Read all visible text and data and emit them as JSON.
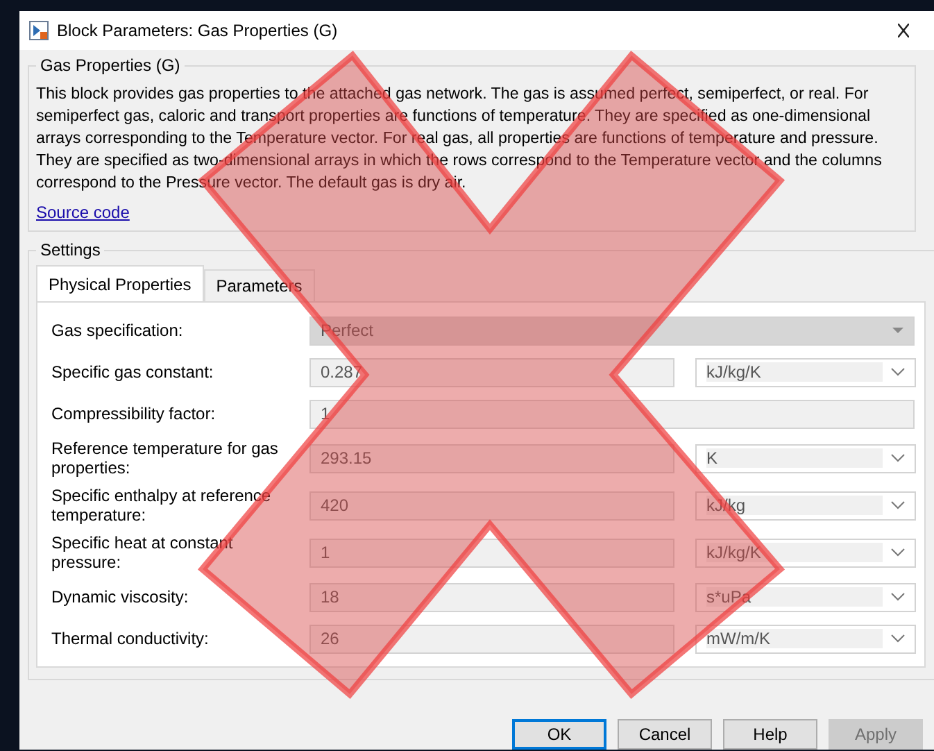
{
  "window": {
    "title": "Block Parameters: Gas Properties (G)"
  },
  "description": {
    "heading": "Gas Properties (G)",
    "text": "This block provides gas properties to the attached gas network. The gas is assumed perfect, semiperfect, or real. For semiperfect gas, caloric and transport properties are functions of temperature. They are specified as one-dimensional arrays corresponding to the Temperature vector. For real gas, all properties are functions of temperature and pressure. They are specified as two-dimensional arrays in which the rows correspond to the Temperature vector and the columns correspond to the Pressure vector. The default gas is dry air.",
    "link": "Source code"
  },
  "settings": {
    "heading": "Settings",
    "tabs": [
      {
        "label": "Physical Properties",
        "selected": true
      },
      {
        "label": "Parameters",
        "selected": false
      }
    ],
    "rows": [
      {
        "kind": "dropdown",
        "label": "Gas specification:",
        "value": "Perfect",
        "disabled": true
      },
      {
        "kind": "value_unit",
        "label": "Specific gas constant:",
        "value": "0.287",
        "unit": "kJ/kg/K",
        "disabled": true
      },
      {
        "kind": "value",
        "label": "Compressibility factor:",
        "value": "1",
        "disabled": true
      },
      {
        "kind": "value_unit",
        "label": "Reference temperature for gas properties:",
        "value": "293.15",
        "unit": "K",
        "disabled": true
      },
      {
        "kind": "value_unit",
        "label": "Specific enthalpy at reference temperature:",
        "value": "420",
        "unit": "kJ/kg",
        "disabled": true
      },
      {
        "kind": "value_unit",
        "label": "Specific heat at constant pressure:",
        "value": "1",
        "unit": "kJ/kg/K",
        "disabled": true
      },
      {
        "kind": "value_unit",
        "label": "Dynamic viscosity:",
        "value": "18",
        "unit": "s*uPa",
        "disabled": true
      },
      {
        "kind": "value_unit",
        "label": "Thermal conductivity:",
        "value": "26",
        "unit": "mW/m/K",
        "disabled": true
      }
    ]
  },
  "buttons": [
    {
      "label": "OK",
      "default": true,
      "disabled": false
    },
    {
      "label": "Cancel",
      "default": false,
      "disabled": false
    },
    {
      "label": "Help",
      "default": false,
      "disabled": false
    },
    {
      "label": "Apply",
      "default": false,
      "disabled": true
    }
  ]
}
